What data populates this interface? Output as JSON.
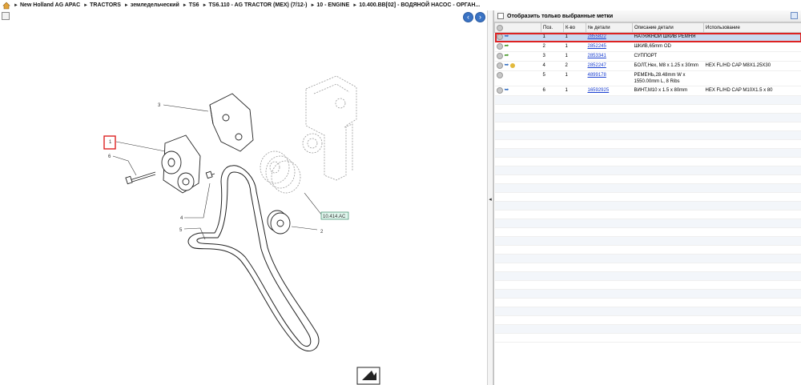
{
  "breadcrumb": {
    "items": [
      "New Holland AG APAC",
      "TRACTORS",
      "земледельческий",
      "TS6",
      "TS6.110 - AG TRACTOR (MEX) (7/12-)",
      "10 - ENGINE",
      "10.400.BB[02] - ВОДЯНОЙ НАСОС - ОРГАН..."
    ]
  },
  "diagram": {
    "callouts": [
      "1",
      "2",
      "3",
      "4",
      "5",
      "6"
    ],
    "reference_label": "10.414.AC"
  },
  "filter": {
    "label": "Отобразить только выбранные метки"
  },
  "table": {
    "headers": [
      "Поз.",
      "К-во",
      "№ детали",
      "Описание детали",
      "Использование"
    ],
    "rows": [
      {
        "pos": "1",
        "qty": "1",
        "part": "2855822",
        "desc": "НАТЯЖНОЙ ШКИВ РЕМНЯ",
        "usage": "",
        "icons": [
          "info",
          "cart"
        ],
        "selected": true
      },
      {
        "pos": "2",
        "qty": "1",
        "part": "2852245",
        "desc": "ШКИВ,65mm OD",
        "usage": "",
        "icons": [
          "info",
          "link"
        ],
        "selected": false
      },
      {
        "pos": "3",
        "qty": "1",
        "part": "2853341",
        "desc": "СУППОРТ",
        "usage": "",
        "icons": [
          "info",
          "link"
        ],
        "selected": false
      },
      {
        "pos": "4",
        "qty": "2",
        "part": "2852247",
        "desc": "БОЛТ,Hex, M8 x 1.25 x 30mm",
        "usage": "HEX FL/HD CAP M8X1.25X30",
        "icons": [
          "info",
          "cart",
          "coin"
        ],
        "selected": false
      },
      {
        "pos": "5",
        "qty": "1",
        "part": "4899178",
        "desc": "РЕМЕНЬ,28.48mm W x 1550.00mm L, 8 Ribs",
        "usage": "",
        "icons": [
          "info"
        ],
        "selected": false
      },
      {
        "pos": "6",
        "qty": "1",
        "part": "16592925",
        "desc": "ВИНТ,M10 x 1.5 x 80mm",
        "usage": "HEX FL/HD CAP M10X1.5 x 80",
        "icons": [
          "info",
          "cart"
        ],
        "selected": false
      }
    ]
  }
}
